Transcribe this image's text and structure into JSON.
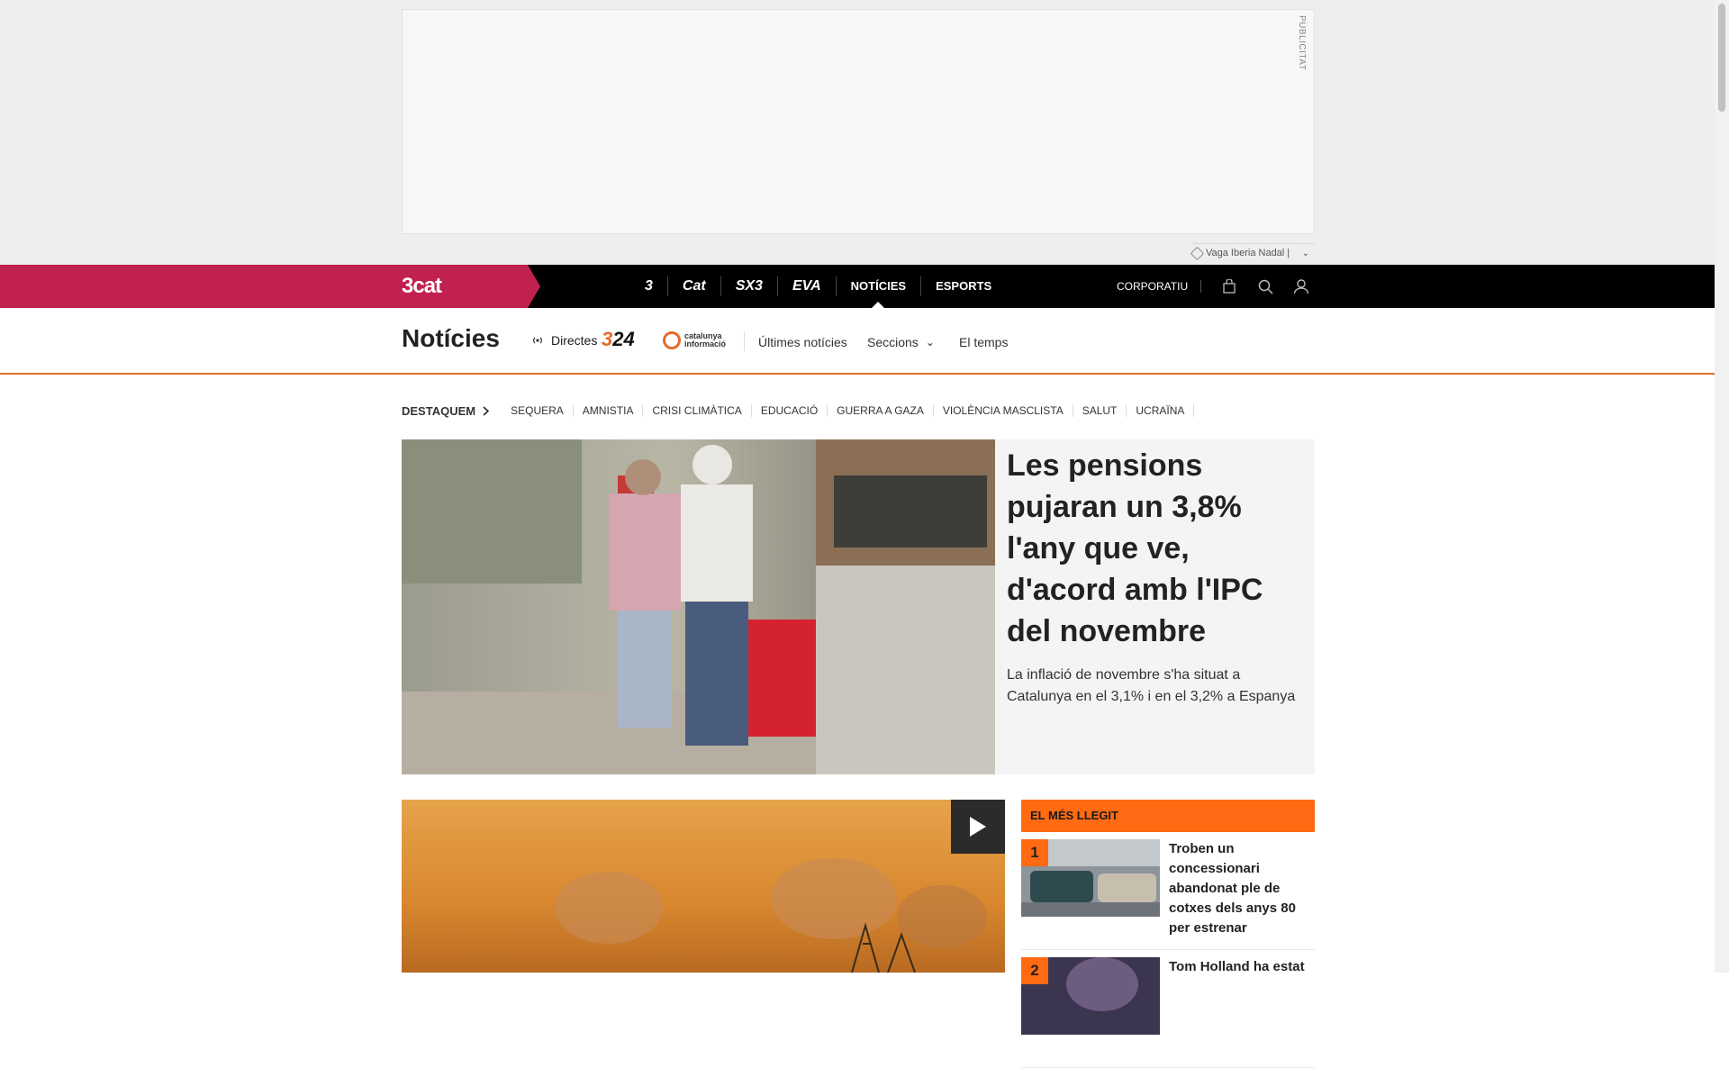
{
  "ad": {
    "label": "PUBLICITAT",
    "promo_label": "Vaga Iberia Nadal |",
    "promo_chevron": "⌄"
  },
  "topbar": {
    "brand": "3cat",
    "channels": [
      {
        "label": "3"
      },
      {
        "label": "Cat"
      },
      {
        "label": "SX3"
      },
      {
        "label": "EVA"
      },
      {
        "label": "NOTÍCIES"
      },
      {
        "label": "ESPORTS"
      }
    ],
    "corporate": "CORPORATIU",
    "icons": [
      "bag-icon",
      "search-icon",
      "user-icon"
    ]
  },
  "section": {
    "title": "Notícies",
    "live": "Directes",
    "logo324": {
      "prefix": "3",
      "suffix": "24"
    },
    "catinfo": {
      "line1": "catalunya",
      "line2": "informació"
    },
    "links": [
      "Últimes notícies",
      "Seccions",
      "El temps"
    ],
    "seccions_chevron": "⌄"
  },
  "highlights": {
    "heading": "DESTAQUEM",
    "items": [
      "SEQUERA",
      "AMNISTIA",
      "CRISI CLIMÀTICA",
      "EDUCACIÓ",
      "GUERRA A GAZA",
      "VIOLÈNCIA MASCLISTA",
      "SALUT",
      "UCRAÏNA"
    ]
  },
  "lead": {
    "title": "Les pensions pujaran un 3,8% l'any que ve, d'acord amb l'IPC del novembre",
    "subtitle": "La inflació de novembre s'ha situat a Catalunya en el 3,1% i en el 3,2% a Espanya"
  },
  "most_read": {
    "heading": "EL MÉS LLEGIT",
    "items": [
      {
        "rank": "1",
        "title": "Troben un concessionari abandonat ple de cotxes dels anys 80 per estrenar"
      },
      {
        "rank": "2",
        "title": "Tom Holland ha estat"
      }
    ]
  },
  "colors": {
    "brand": "#c0214f",
    "accent": "#ff6a13",
    "topbar": "#000000"
  }
}
